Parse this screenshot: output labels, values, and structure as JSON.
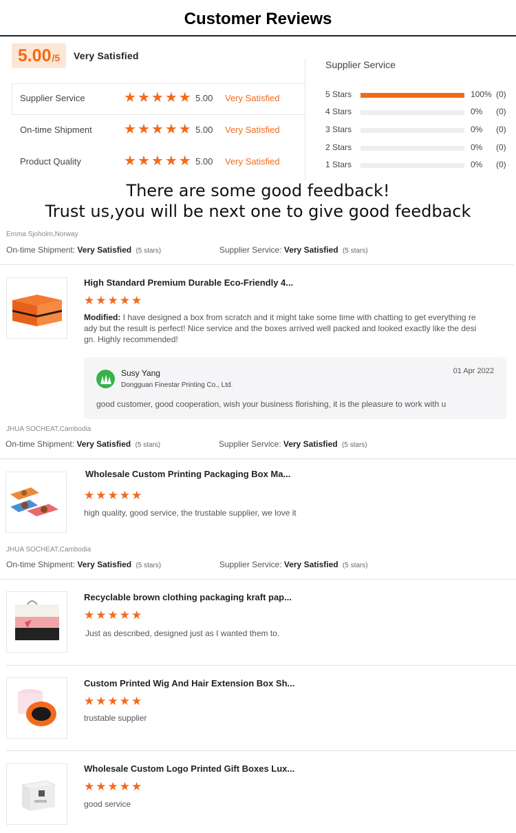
{
  "header": {
    "title": "Customer Reviews"
  },
  "summary": {
    "score": "5.00",
    "score_denominator": "/5",
    "score_label": "Very Satisfied",
    "rows": [
      {
        "label": "Supplier Service",
        "score": "5.00",
        "desc": "Very Satisfied",
        "stars": 5
      },
      {
        "label": "On-time Shipment",
        "score": "5.00",
        "desc": "Very Satisfied",
        "stars": 5
      },
      {
        "label": "Product Quality",
        "score": "5.00",
        "desc": "Very Satisfied",
        "stars": 5
      }
    ]
  },
  "distribution": {
    "title": "Supplier Service",
    "rows": [
      {
        "label": "5 Stars",
        "pct": "100%",
        "count": "(0)",
        "fraction": 1.0
      },
      {
        "label": "4 Stars",
        "pct": "0%",
        "count": "(0)",
        "fraction": 0
      },
      {
        "label": "3 Stars",
        "pct": "0%",
        "count": "(0)",
        "fraction": 0
      },
      {
        "label": "2 Stars",
        "pct": "0%",
        "count": "(0)",
        "fraction": 0
      },
      {
        "label": "1 Stars",
        "pct": "0%",
        "count": "(0)",
        "fraction": 0
      }
    ]
  },
  "banner": {
    "line1": "There are some good feedback!",
    "line2": "Trust us,you will be next one to give good feedback"
  },
  "meta_common": {
    "shipment_label": "On-time Shipment:",
    "shipment_value": "Very Satisfied",
    "service_label": "Supplier Service:",
    "service_value": "Very Satisfied",
    "stars_note": "(5 stars)"
  },
  "reviews": [
    {
      "reviewer": "Emma Sjoholm,Norway",
      "product_title": "High Standard Premium Durable Eco-Friendly 4...",
      "stars": 5,
      "comment_prefix": "Modified:",
      "comment": "I have designed a box from scratch and it might take some time with chatting to get everything re ady but the result is perfect! Nice service and the boxes arrived well packed and looked exactly like the desi gn. Highly recommended!",
      "reply": {
        "name": "Susy Yang",
        "company": "Dongguan Finestar Printing Co., Ltd.",
        "date": "01 Apr 2022",
        "text": "good customer, good cooperation, wish your business florishing, it is the pleasure to work with u"
      }
    },
    {
      "reviewer": "JHUA SOCHEAT,Cambodia",
      "product_title": "Wholesale Custom Printing Packaging Box Ma...",
      "stars": 5,
      "comment": "high quality, good service, the trustable supplier, we love it"
    },
    {
      "reviewer": "JHUA SOCHEAT,Cambodia",
      "product_title": "Recyclable brown clothing packaging kraft pap...",
      "stars": 5,
      "comment": "Just as described, designed just as I wanted them to."
    },
    {
      "product_title": "Custom Printed Wig And Hair Extension Box Sh...",
      "stars": 5,
      "comment": "trustable supplier"
    },
    {
      "product_title": "Wholesale Custom Logo Printed Gift Boxes Lux...",
      "stars": 5,
      "comment": "good service"
    }
  ],
  "colors": {
    "accent": "#f26a1b",
    "score_bg": "#fde6d4",
    "reply_avatar": "#36b24a"
  },
  "icons": [
    "star-icon",
    "supplier-avatar-icon"
  ]
}
